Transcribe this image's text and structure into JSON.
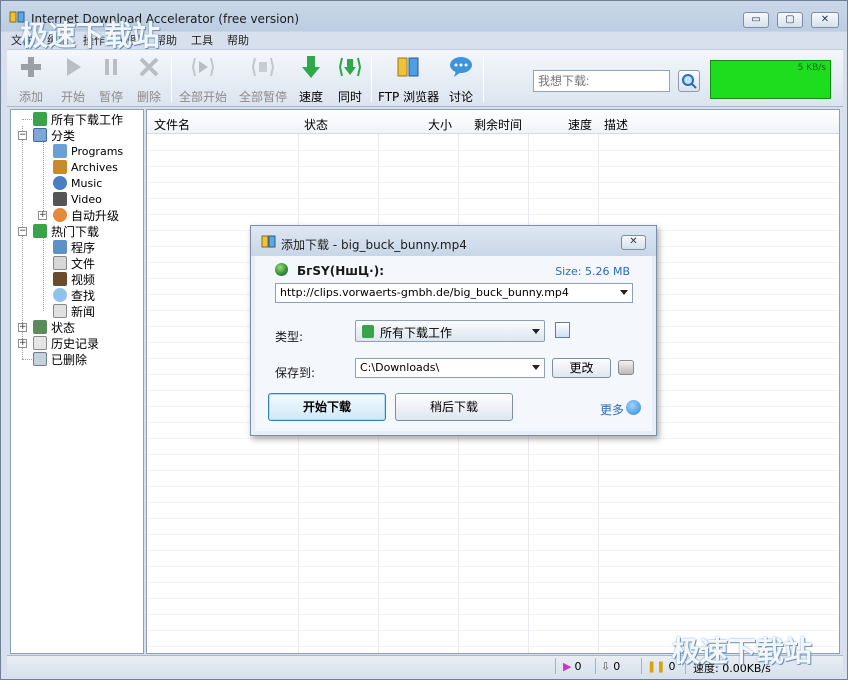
{
  "window": {
    "title": "Internet Download Accelerator (free version)",
    "controls": {
      "minimize": "▭",
      "maximize": "▢",
      "close": "✕"
    }
  },
  "menu": [
    "文件",
    "编辑",
    "操作",
    "视图",
    "帮助",
    "工具",
    "帮助"
  ],
  "toolbar": {
    "buttons": [
      "添加",
      "开始",
      "暂停",
      "删除",
      "全部开始",
      "全部暂停",
      "速度",
      "同时",
      "FTP 浏览器",
      "讨论"
    ],
    "search_placeholder": "我想下载:",
    "speed_graph_label": "5 KB/s"
  },
  "tree": {
    "root": "所有下载工作",
    "categories": "分类",
    "cat_items": [
      "Programs",
      "Archives",
      "Music",
      "Video",
      "自动升级"
    ],
    "hot": "热门下载",
    "hot_items": [
      "程序",
      "文件",
      "视频",
      "查找",
      "新闻"
    ],
    "status": "状态",
    "history": "历史记录",
    "deleted": "已删除"
  },
  "list": {
    "columns": [
      "文件名",
      "状态",
      "大小",
      "剩余时间",
      "速度",
      "描述"
    ]
  },
  "statusbar": {
    "active": "0",
    "queued": "0",
    "paused": "0",
    "speed": "速度: 0.00KB/s"
  },
  "dialog": {
    "title": "添加下载 - big_buck_bunny.mp4",
    "file_label": "БгЅҮ(НшЦ·):",
    "size": "Size: 5.26 MB",
    "url": "http://clips.vorwaerts-gmbh.de/big_buck_bunny.mp4",
    "type_label": "类型:",
    "type_value": "所有下载工作",
    "save_label": "保存到:",
    "save_path": "C:\\Downloads\\",
    "change_button": "更改",
    "start_button": "开始下载",
    "later_button": "稍后下载",
    "more_link": "更多"
  },
  "watermark": "极速下载站",
  "colors": {
    "speed_graph": "#1edc1e",
    "link": "#2a6bb7",
    "toolbar_green": "#2ea84a"
  }
}
